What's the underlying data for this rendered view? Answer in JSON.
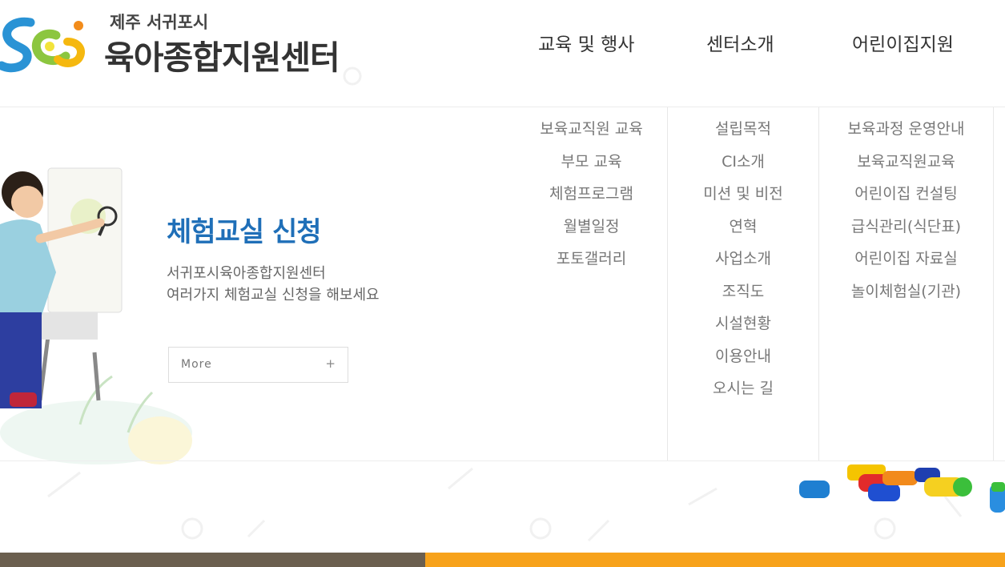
{
  "brand": {
    "subtitle": "제주 서귀포시",
    "title": "육아종합지원센터"
  },
  "nav": {
    "items": [
      {
        "label": "교육 및 행사"
      },
      {
        "label": "센터소개"
      },
      {
        "label": "어린이집지원"
      }
    ]
  },
  "submenus": [
    {
      "items": [
        "보육교직원 교육",
        "부모 교육",
        "체험프로그램",
        "월별일정",
        "포토갤러리"
      ]
    },
    {
      "items": [
        "설립목적",
        "CI소개",
        "미션 및 비전",
        "연혁",
        "사업소개",
        "조직도",
        "시설현황",
        "이용안내",
        "오시는 길"
      ]
    },
    {
      "items": [
        "보육과정 운영안내",
        "보육교직원교육",
        "어린이집 컨설팅",
        "급식관리(식단표)",
        "어린이집 자료실",
        "놀이체험실(기관)"
      ]
    }
  ],
  "hero": {
    "title": "체험교실 신청",
    "desc_line1": "서귀포시육아종합지원센터",
    "desc_line2": "여러가지 체험교실 신청을 해보세요",
    "more_label": "More",
    "more_icon": "plus-icon"
  },
  "colors": {
    "accent_blue": "#1f6fb8",
    "footer_left": "#6b5f4f",
    "footer_right": "#f7a21b"
  }
}
